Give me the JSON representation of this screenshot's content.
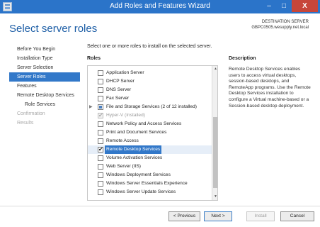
{
  "window": {
    "title": "Add Roles and Features Wizard",
    "minimize_glyph": "–",
    "maximize_glyph": "□",
    "close_glyph": "X"
  },
  "header": {
    "page_title": "Select server roles",
    "dest_server_label": "DESTINATION SERVER",
    "dest_server_value": "GBPC0505.wesupply.net.local"
  },
  "nav": {
    "items": [
      {
        "label": "Before You Begin",
        "state": "normal"
      },
      {
        "label": "Installation Type",
        "state": "normal"
      },
      {
        "label": "Server Selection",
        "state": "normal"
      },
      {
        "label": "Server Roles",
        "state": "active"
      },
      {
        "label": "Features",
        "state": "normal"
      },
      {
        "label": "Remote Desktop Services",
        "state": "normal"
      },
      {
        "label": "Role Services",
        "state": "sub"
      },
      {
        "label": "Confirmation",
        "state": "disabled"
      },
      {
        "label": "Results",
        "state": "disabled"
      }
    ]
  },
  "main": {
    "instructions": "Select one or more roles to install on the selected server.",
    "roles_label": "Roles",
    "roles": [
      {
        "label": "Application Server",
        "checked": "no",
        "expandable": false
      },
      {
        "label": "DHCP Server",
        "checked": "no",
        "expandable": false
      },
      {
        "label": "DNS Server",
        "checked": "no",
        "expandable": false
      },
      {
        "label": "Fax Server",
        "checked": "no",
        "expandable": false
      },
      {
        "label": "File and Storage Services (2 of 12 installed)",
        "checked": "partial",
        "expandable": true
      },
      {
        "label": "Hyper-V (Installed)",
        "checked": "disabled",
        "expandable": false
      },
      {
        "label": "Network Policy and Access Services",
        "checked": "no",
        "expandable": false
      },
      {
        "label": "Print and Document Services",
        "checked": "no",
        "expandable": false
      },
      {
        "label": "Remote Access",
        "checked": "no",
        "expandable": false
      },
      {
        "label": "Remote Desktop Services",
        "checked": "yes",
        "expandable": false,
        "selected": true
      },
      {
        "label": "Volume Activation Services",
        "checked": "no",
        "expandable": false
      },
      {
        "label": "Web Server (IIS)",
        "checked": "no",
        "expandable": false
      },
      {
        "label": "Windows Deployment Services",
        "checked": "no",
        "expandable": false
      },
      {
        "label": "Windows Server Essentials Experience",
        "checked": "no",
        "expandable": false
      },
      {
        "label": "Windows Server Update Services",
        "checked": "no",
        "expandable": false
      }
    ],
    "description_label": "Description",
    "description_text": "Remote Desktop Services enables users to access virtual desktops, session-based desktops, and RemoteApp programs. Use the Remote Desktop Services installation to configure a Virtual machine-based or a Session-based desktop deployment."
  },
  "footer": {
    "previous_label": "< Previous",
    "next_label": "Next >",
    "install_label": "Install",
    "cancel_label": "Cancel"
  },
  "colors": {
    "titlebar": "#2b74c9",
    "accent": "#1d5ea6",
    "selection": "#3278c9",
    "close": "#c7463a"
  }
}
